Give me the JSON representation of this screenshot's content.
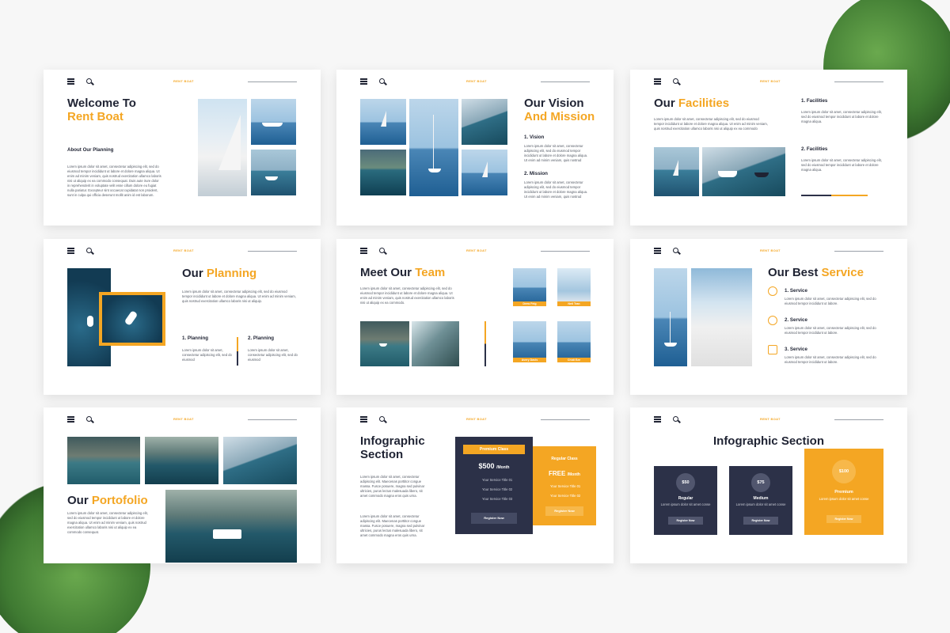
{
  "brand": "RENT BOAT",
  "slide1": {
    "title1": "Welcome To",
    "title2": "Rent Boat",
    "subtitle": "About Our Planning",
    "body": "Lorem ipsum dolor sit amet, consectetur adipiscing elit, sed do eiusmod tempor incididunt ut labore et dolore magna aliqua. Ut enim ad minim veniam, quis nostrud exercitation ullamco laboris nisi ut aliquip ex ea commodo consequat. Duis aute irure dolor in reprehenderit in voluptate velit esse cillum dolore eu fugiat nulla pariatur. Excepteur sint occaecat cupidatat non proident, sunt in culpa qui officia deserunt mollit anim id est laborum."
  },
  "slide2": {
    "title1": "Our Vision",
    "title2": "And Mission",
    "vision_label": "1. Vision",
    "vision_body": "Lorem ipsum dolor sit amet, consectetur adipiscing elit, sed do eiusmod tempor incididunt ut labore et dolore magna aliqua. Ut enim ad minim veniam, quis nostrud exercitation ullamco.",
    "mission_label": "2. Mission",
    "mission_body": "Lorem ipsum dolor sit amet, consectetur adipiscing elit, sed do eiusmod tempor incididunt ut labore et dolore magna aliqua. Ut enim ad minim veniam, quis nostrud exercitation ullamco."
  },
  "slide3": {
    "title1": "Our",
    "title2": "Facilities",
    "body": "Lorem ipsum dolor sit amet, consectetur adipiscing elit, sed do eiusmod tempor incididunt ut labore et dolore magna aliqua. Ut enim ad minim veniam, quis nostrud exercitation ullamco laboris nisi ut aliquip ex ea commodo consequat. Duis aute irure dolor in reprehenderit in voluptate velit esse.",
    "f1_label": "1. Facilities",
    "f1_body": "Lorem ipsum dolor sit amet, consectetur adipiscing elit, sed do eiusmod tempor incididunt ut labore et dolore magna aliqua.",
    "f2_label": "2. Facilities",
    "f2_body": "Lorem ipsum dolor sit amet, consectetur adipiscing elit, sed do eiusmod tempor incididunt ut labore et dolore magna aliqua."
  },
  "slide4": {
    "title1": "Our",
    "title2": "Planning",
    "body": "Lorem ipsum dolor sit amet, consectetur adipiscing elit, sed do eiusmod tempor incididunt ut labore et dolore magna aliqua. Ut enim ad minim veniam, quis nostrud exercitation ullamco laboris nisi ut aliquip.",
    "p1_label": "1. Planning",
    "p1_body": "Lorem ipsum dolor sit amet, consectetur adipiscing elit, sed do eiusmod",
    "p2_label": "2. Planning",
    "p2_body": "Lorem ipsum dolor sit amet, consectetur adipiscing elit, sed do eiusmod"
  },
  "slide5": {
    "title1": "Meet Our",
    "title2": "Team",
    "body": "Lorem ipsum dolor sit amet, consectetur adipiscing elit, sed do eiusmod tempor incididunt ut labore et dolore magna aliqua. Ut enim ad minim veniam, quis nostrud exercitation ullamco laboris nisi ut aliquip ex ea commodo.",
    "members": [
      "Drew Feig",
      "Neil Tran",
      "Avery Davis",
      "Chidi Eze"
    ]
  },
  "slide6": {
    "title1": "Our Best",
    "title2": "Service",
    "services": [
      {
        "label": "1. Service",
        "body": "Lorem ipsum dolor sit amet, consectetur adipiscing elit, sed do eiusmod tempor incididunt ut labore."
      },
      {
        "label": "2. Service",
        "body": "Lorem ipsum dolor sit amet, consectetur adipiscing elit, sed do eiusmod tempor incididunt ut labore."
      },
      {
        "label": "3. Service",
        "body": "Lorem ipsum dolor sit amet, consectetur adipiscing elit, sed do eiusmod tempor incididunt ut labore."
      }
    ]
  },
  "slide7": {
    "title1": "Our",
    "title2": "Portofolio",
    "body": "Lorem ipsum dolor sit amet, consectetur adipiscing elit, sed do eiusmod tempor incididunt ut labore et dolore magna aliqua. Ut enim ad minim veniam, quis nostrud exercitation ullamco laboris nisi ut aliquip ex ea commodo consequat."
  },
  "slide8": {
    "title1": "Infographic",
    "title2": "Section",
    "body1": "Lorem ipsum dolor sit amet, consectetur adipiscing elit. Maecenas porttitor congue massa. Fusce posuere, magna sed pulvinar ultricies, purus lectus malesuada libero, sit amet commodo magna eros quis urna.",
    "body2": "Lorem ipsum dolor sit amet, consectetur adipiscing elit. Maecenas porttitor congue massa. Fusce posuere, magna sed pulvinar ultricies, purus lectus malesuada libero, sit amet commodo magna eros quis urna.",
    "premium": {
      "name": "Premium Class",
      "price": "$500",
      "per": "/Month",
      "items": [
        "Your Service Title 01",
        "Your Service Title 02",
        "Your Service Title 03"
      ],
      "button": "Register Now"
    },
    "regular": {
      "name": "Regular Class",
      "price": "FREE",
      "per": "/Month",
      "items": [
        "Your Service Title 01",
        "Your Service Title 02"
      ],
      "button": "Register Now"
    }
  },
  "slide9": {
    "title": "Infographic Section",
    "plans": [
      {
        "price": "$50",
        "name": "Regular",
        "desc": "Lorem ipsum dolor sit amet conse",
        "button": "Register Now"
      },
      {
        "price": "$75",
        "name": "Medium",
        "desc": "Lorem ipsum dolor sit amet conse",
        "button": "Register Now"
      },
      {
        "price": "$100",
        "name": "Premium",
        "desc": "Lorem ipsum dolor sit amet conse",
        "button": "Register Now"
      }
    ]
  },
  "colors": {
    "accent": "#f4a623",
    "navy": "#2c3148",
    "plant": "#4c8a3c"
  }
}
